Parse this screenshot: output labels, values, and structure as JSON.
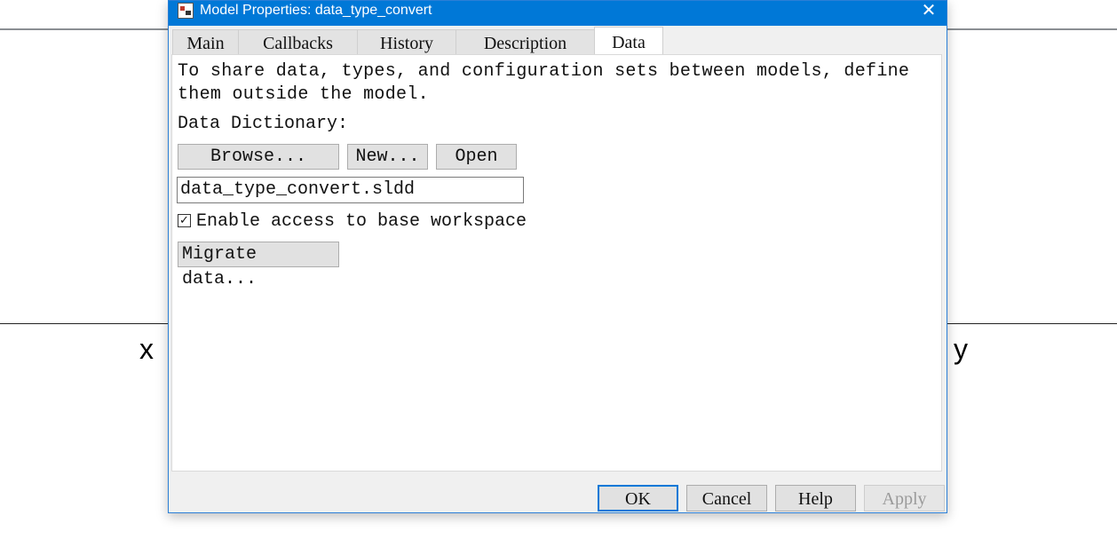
{
  "background": {
    "input_label": "x",
    "output_label": "y"
  },
  "dialog": {
    "title": "Model Properties: data_type_convert",
    "close_glyph": "✕",
    "icon": "simulink-model-icon",
    "accent_color": "#0078d7"
  },
  "tabs": [
    {
      "label": "Main",
      "active": false
    },
    {
      "label": "Callbacks",
      "active": false
    },
    {
      "label": "History",
      "active": false
    },
    {
      "label": "Description",
      "active": false
    },
    {
      "label": "Data",
      "active": true
    }
  ],
  "data_tab": {
    "description": "To share data, types, and configuration sets between models, define them outside the model.",
    "dictionary_label": "Data Dictionary:",
    "browse_label": "Browse...",
    "new_label": "New...",
    "open_label": "Open",
    "dictionary_value": "data_type_convert.sldd",
    "base_workspace_checked": true,
    "checkbox_glyph": "✓",
    "base_workspace_label": "Enable access to base workspace",
    "migrate_label": "Migrate data..."
  },
  "footer": {
    "ok_label": "OK",
    "cancel_label": "Cancel",
    "help_label": "Help",
    "apply_label": "Apply",
    "apply_enabled": false
  }
}
